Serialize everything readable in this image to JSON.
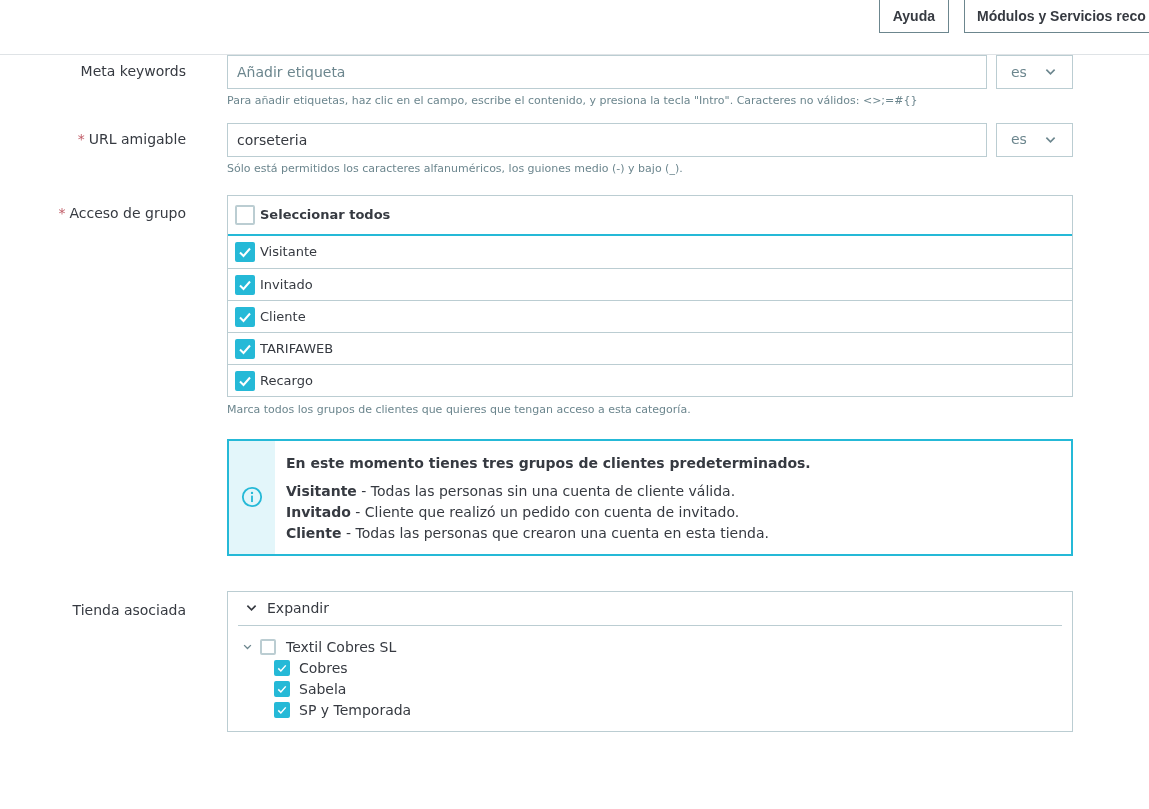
{
  "header": {
    "buttons": [
      "Ayuda",
      "Módulos y Servicios reco"
    ]
  },
  "fields": [
    {
      "label": "Meta keywords",
      "placeholder": "Añadir etiqueta",
      "language": "es",
      "help": "Para añadir etiquetas, haz clic en el campo, escribe el contenido, y presiona la tecla \"Intro\". Caracteres no válidos: <>;=#{}"
    },
    {
      "required_mark": "*",
      "label": "URL amigable",
      "value": "corseteria",
      "language": "es",
      "help": "Sólo está permitidos los caracteres alfanuméricos, los guiones medio (-) y bajo (_)."
    }
  ],
  "group_access": {
    "required_mark": "*",
    "label": "Acceso de grupo",
    "select_all": {
      "label": "Seleccionar todos",
      "checked": false
    },
    "groups": [
      {
        "label": "Visitante",
        "checked": true
      },
      {
        "label": "Invitado",
        "checked": true
      },
      {
        "label": "Cliente",
        "checked": true
      },
      {
        "label": "TARIFAWEB",
        "checked": true
      },
      {
        "label": "Recargo",
        "checked": true
      }
    ],
    "help": "Marca todos los grupos de clientes que quieres que tengan acceso a esta categoría.",
    "info": {
      "title": "En este momento tienes tres grupos de clientes predeterminados.",
      "lines": [
        "**Visitante** - Todas las personas sin una cuenta de cliente válida.",
        "**Invitado** - Cliente que realizó un pedido con cuenta de invitado.",
        "**Cliente** - Todas las personas que crearon una cuenta en esta tienda."
      ]
    }
  },
  "shop": {
    "label": "Tienda asociada",
    "toggle": "Expandir",
    "tree": [
      {
        "label": "Textil Cobres SL",
        "checked": false,
        "expanded": true,
        "children": [
          {
            "label": "Cobres",
            "checked": true
          },
          {
            "label": "Sabela",
            "checked": true
          },
          {
            "label": "SP y Temporada",
            "checked": true
          }
        ]
      }
    ]
  }
}
